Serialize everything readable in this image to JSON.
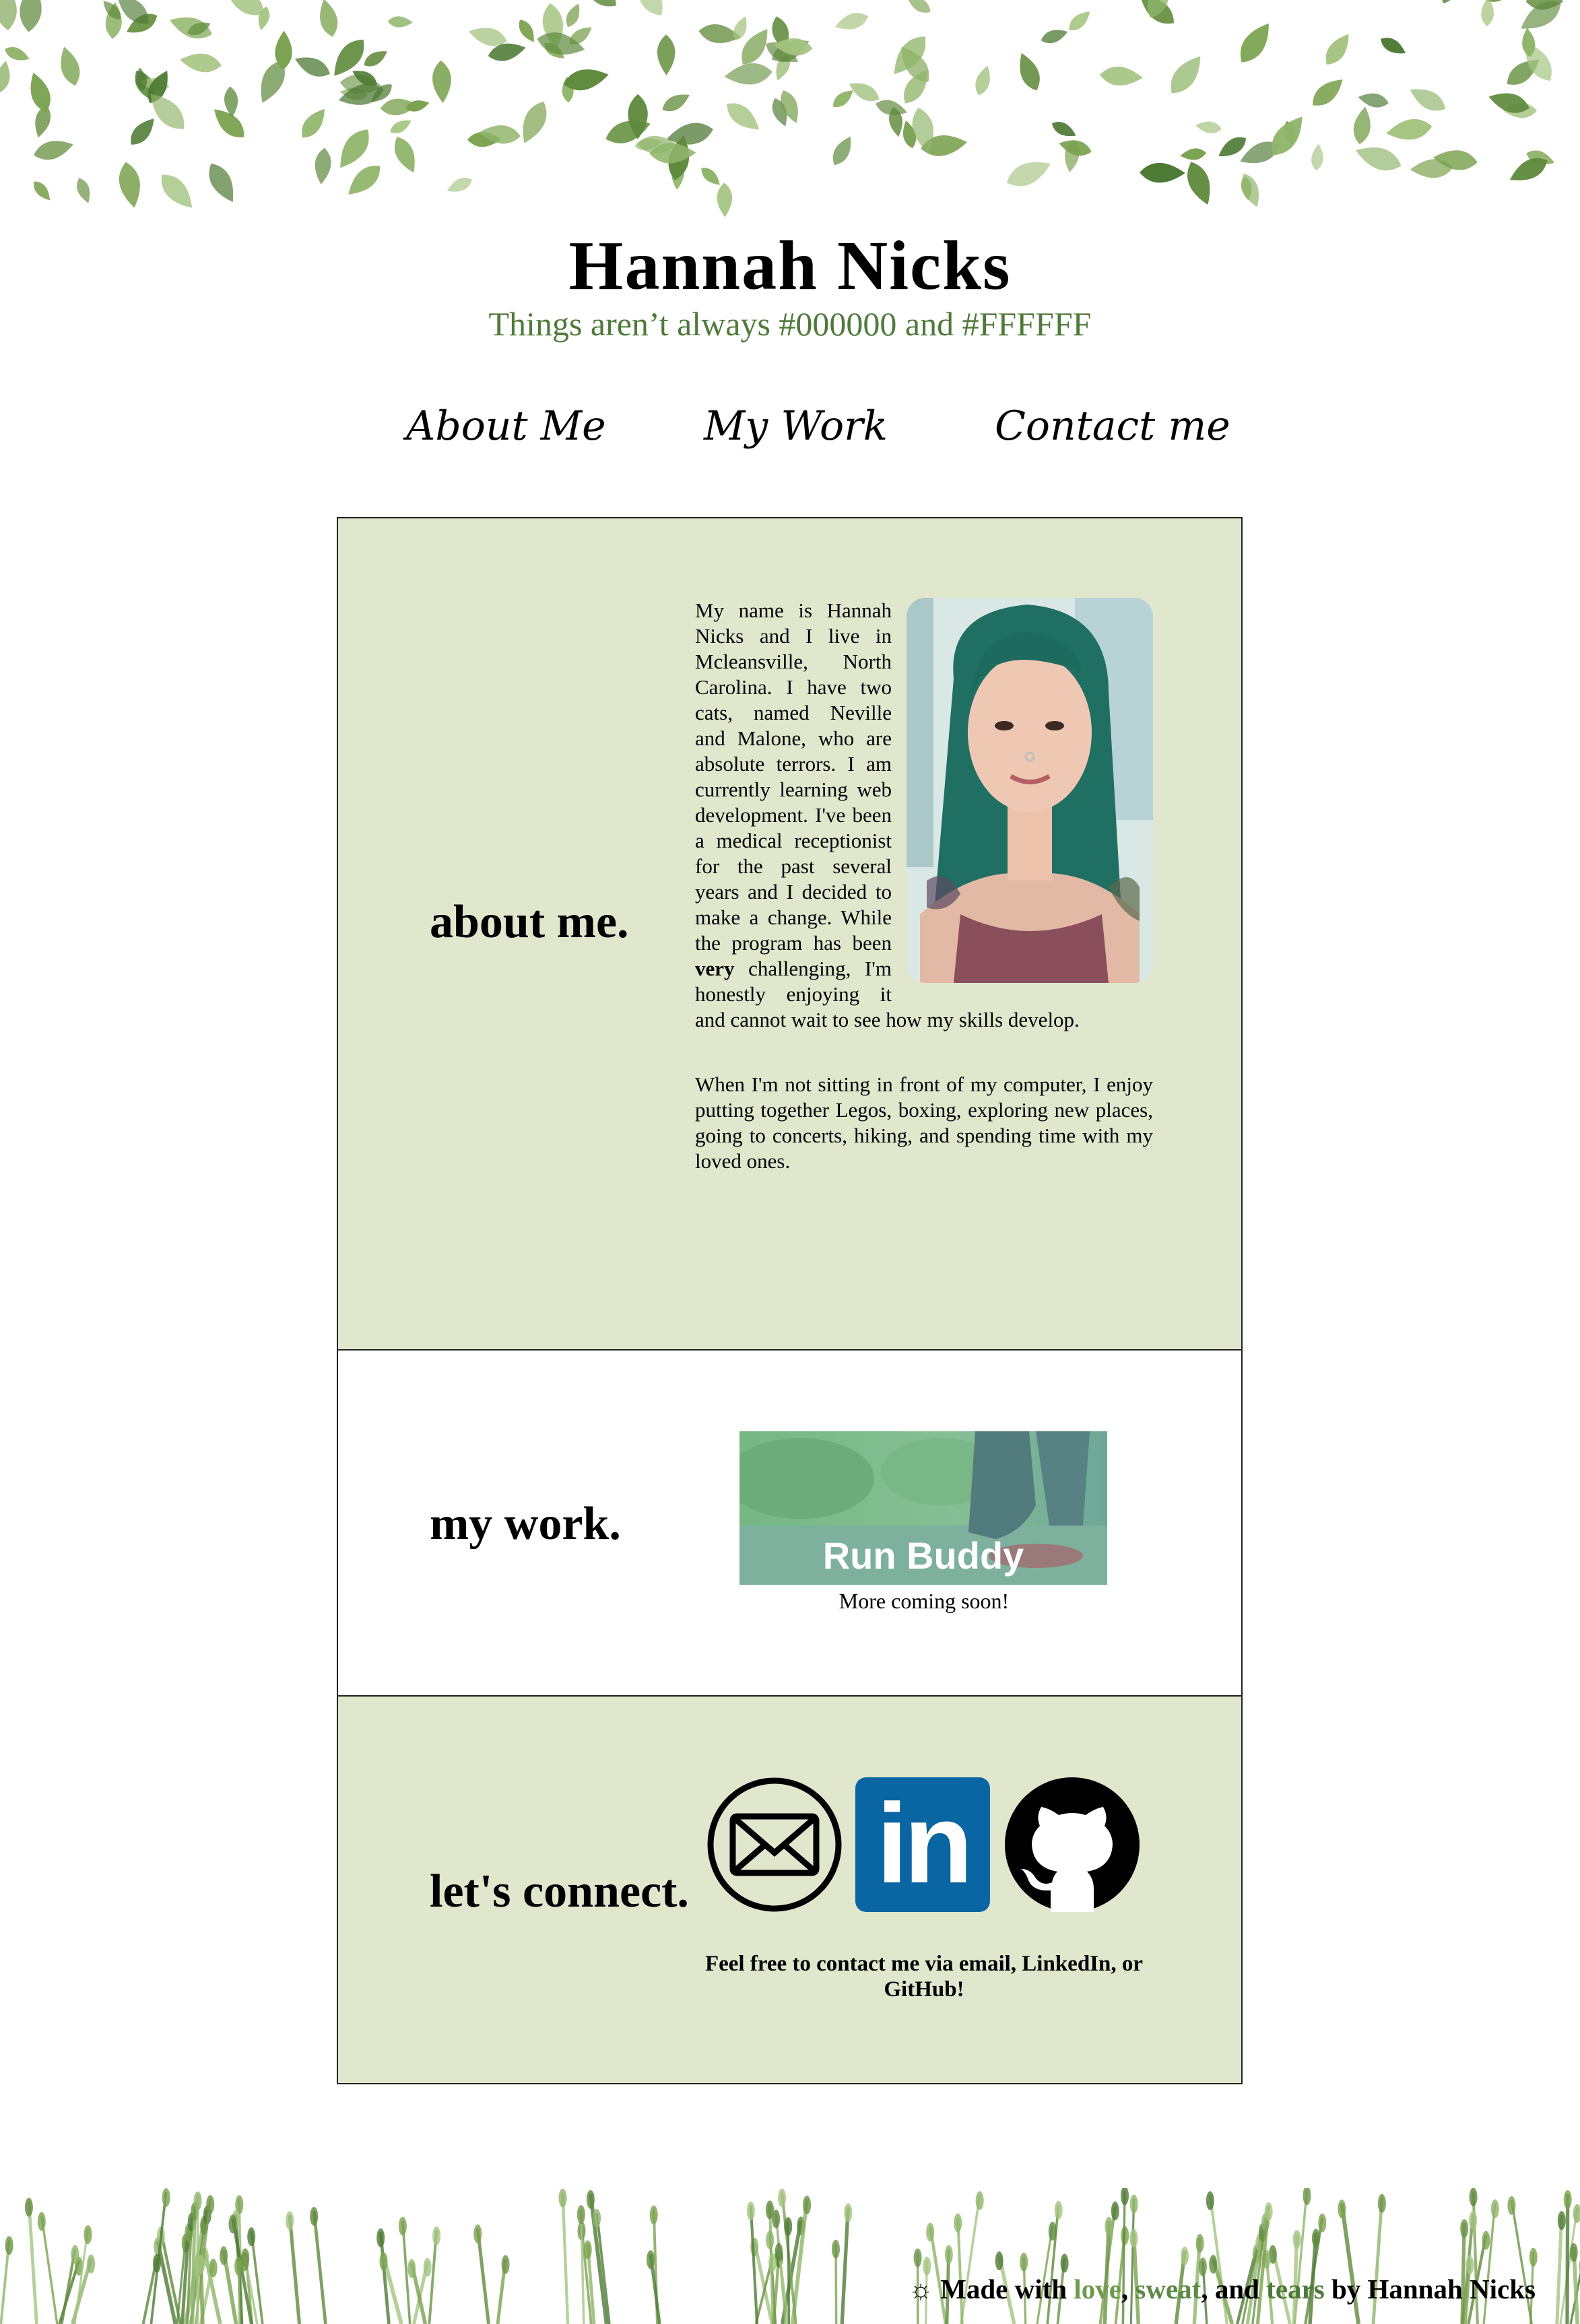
{
  "header": {
    "name": "Hannah Nicks",
    "tagline": "Things aren’t always #000000 and #FFFFFF"
  },
  "nav": {
    "about": "About Me",
    "work": "My Work",
    "contact": "Contact me"
  },
  "about": {
    "heading": "about me.",
    "p1_before": "My name is Hannah Nicks and I live in Mcleansville, North Carolina. I have two cats, named Neville and Malone, who are absolute terrors. I am currently learning web development. I've been a medical receptionist for the past several years and I decided to make a change. While the program has been ",
    "p1_bold": "very",
    "p1_after": " challenging, I'm honestly enjoying it and cannot wait to see how my skills develop.",
    "p2": "When I'm not sitting in front of my computer, I enjoy putting together Legos, boxing, exploring new places, going to concerts, hiking, and spending time with my loved ones."
  },
  "work": {
    "heading": "my work.",
    "project_label": "Run Buddy",
    "coming_soon": "More coming soon!"
  },
  "connect": {
    "heading": "let's connect.",
    "icons": [
      "envelope-icon",
      "linkedin-icon",
      "github-icon"
    ],
    "linkedin_text": "in",
    "note": "Feel free to contact me via email, LinkedIn, or GitHub!"
  },
  "footer": {
    "sun": "☼",
    "made_with": "Made with",
    "love": "love",
    "comma1": ",",
    "sweat": "sweat",
    "and": ", and",
    "tears": "tears",
    "by": "by Hannah Nicks"
  },
  "colors": {
    "section_green": "#e0e7cd",
    "tagline_green": "#4f7a3a",
    "linkedin_blue": "#0a66a2",
    "footer_love": "#6e9a4c",
    "footer_sweat": "#5d8a46",
    "footer_tears": "#4c7a3a"
  }
}
